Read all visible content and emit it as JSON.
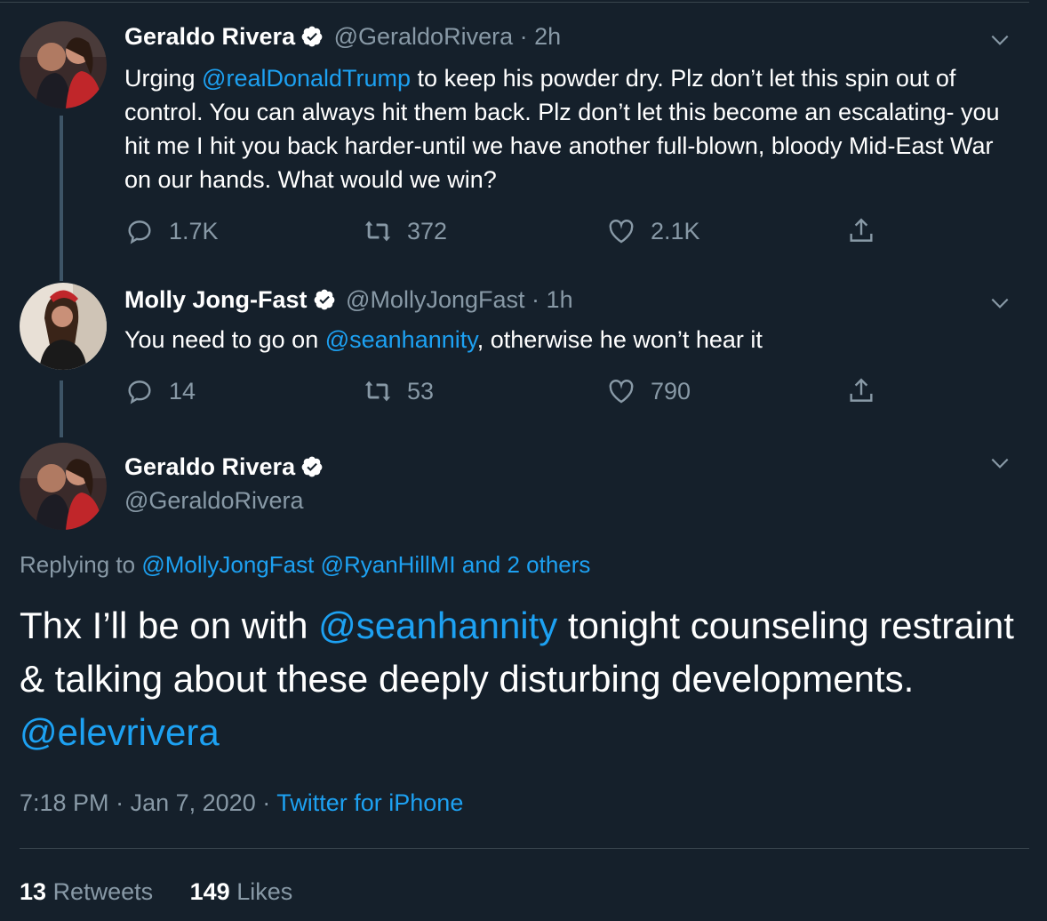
{
  "tweet1": {
    "name": "Geraldo Rivera",
    "handle": "@GeraldoRivera",
    "sep": "·",
    "time": "2h",
    "text_before": "Urging ",
    "mention": "@realDonaldTrump",
    "text_after": " to keep his powder dry. Plz don’t let this spin out of control. You can always hit them back. Plz don’t let this become an escalating- you hit me I hit you back harder-until we have another full-blown, bloody Mid-East War on our hands. What would we win?",
    "replies": "1.7K",
    "retweets": "372",
    "likes": "2.1K"
  },
  "tweet2": {
    "name": "Molly Jong-Fast",
    "handle": "@MollyJongFast",
    "sep": "·",
    "time": "1h",
    "text_before": "You need to go on ",
    "mention": "@seanhannity",
    "text_after": ", otherwise he won’t hear it",
    "replies": "14",
    "retweets": "53",
    "likes": "790"
  },
  "main": {
    "name": "Geraldo Rivera",
    "handle": "@GeraldoRivera",
    "replying_label": "Replying to ",
    "replying_mention1": "@MollyJongFast",
    "replying_mention2": "@RyanHillMI",
    "replying_others": "and 2 others",
    "text1": "Thx I’ll be on with ",
    "mention1": "@seanhannity",
    "text2": " tonight counseling restraint & talking about these deeply disturbing developments. ",
    "mention2": "@elevrivera",
    "time": "7:18 PM",
    "sep1": "·",
    "date": "Jan 7, 2020",
    "sep2": "·",
    "source": "Twitter for iPhone",
    "retweets_count": "13",
    "retweets_label": "Retweets",
    "likes_count": "149",
    "likes_label": "Likes"
  },
  "colors": {
    "background": "#15202b",
    "link": "#1da1f2",
    "muted": "#8899a6",
    "verified": "#ffffff"
  },
  "icons": [
    "reply-icon",
    "retweet-icon",
    "like-icon",
    "share-icon",
    "verified-icon",
    "chevron-down-icon"
  ]
}
